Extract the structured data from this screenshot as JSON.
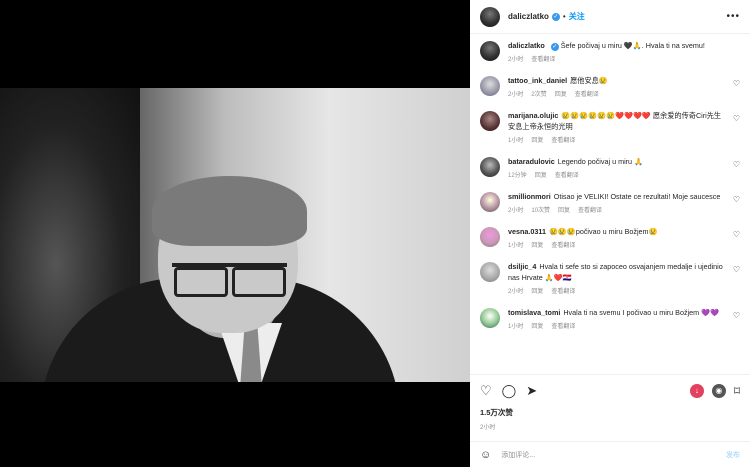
{
  "header": {
    "username": "daliczlatko",
    "dot": "•",
    "follow_label": "关注",
    "more": "•••"
  },
  "caption": {
    "username": "daliczlatko",
    "text": "Šefe počivaj u miru 🖤🙏. Hvala ti na svemu!",
    "time": "2小时",
    "translate": "查看翻译"
  },
  "comments": [
    {
      "username": "tattoo_ink_daniel",
      "text": "愿他安息😢",
      "time": "2小时",
      "likes": "2次赞",
      "reply": "回复",
      "translate": "查看翻译"
    },
    {
      "username": "marijana.olujic",
      "text": "😢😢😢😢😢😢❤️❤️❤️❤️ 愿余爱的传奇Ciri先生安息上帝永恒的光明",
      "time": "1小时",
      "likes": "",
      "reply": "回复",
      "translate": "查看翻译"
    },
    {
      "username": "bataradulovic",
      "text": "Legendo počivaj u miru 🙏",
      "time": "12分钟",
      "likes": "",
      "reply": "回复",
      "translate": "查看翻译"
    },
    {
      "username": "smillionmori",
      "text": "Otisao je VELIKI! Ostate ce rezultati! Moje saucesce",
      "time": "2小时",
      "likes": "10次赞",
      "reply": "回复",
      "translate": "查看翻译"
    },
    {
      "username": "vesna.0311",
      "text": "😢😢😢počivao u miru Božjem😢",
      "time": "1小时",
      "likes": "",
      "reply": "回复",
      "translate": "查看翻译"
    },
    {
      "username": "dsiljic_4",
      "text": "Hvala ti sefe sto si zapoceo osvajanjem medalje i ujedinio nas Hrvate 🙏❤️🇭🇷",
      "time": "2小时",
      "likes": "",
      "reply": "回复",
      "translate": "查看翻译"
    },
    {
      "username": "tomislava_tomi",
      "text": "Hvala ti na svemu I počivao u miru Božjem 💜💜",
      "time": "1小时",
      "likes": "",
      "reply": "回复",
      "translate": "查看翻译"
    }
  ],
  "actions": {
    "like_icon": "♡",
    "comment_icon": "◯",
    "share_icon": "➤",
    "bookmark_icon": "⌑",
    "like_count": "1.5万次赞",
    "time": "2小时"
  },
  "add_comment": {
    "emoji": "☺",
    "placeholder": "添加评论...",
    "post_label": "发布"
  },
  "colors": {
    "accent": "#0095f6",
    "verified": "#3897f0"
  }
}
